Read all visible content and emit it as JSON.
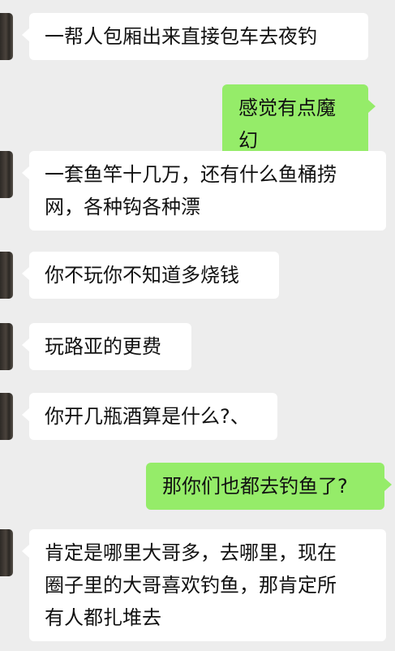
{
  "colors": {
    "background": "#ededed",
    "incoming_bubble": "#ffffff",
    "outgoing_bubble": "#95ec69",
    "text": "#111111"
  },
  "messages": [
    {
      "side": "left",
      "text": "一帮人包厢出来直接包车去夜钓"
    },
    {
      "side": "right",
      "text": "感觉有点魔幻"
    },
    {
      "side": "left",
      "text": "一套鱼竿十几万，还有什么鱼桶捞\n网，各种钩各种漂"
    },
    {
      "side": "left",
      "text": "你不玩你不知道多烧钱"
    },
    {
      "side": "left",
      "text": "玩路亚的更费"
    },
    {
      "side": "left",
      "text": "你开几瓶酒算是什么?、"
    },
    {
      "side": "right",
      "text": "那你们也都去钓鱼了?"
    },
    {
      "side": "left",
      "text": "肯定是哪里大哥多，去哪里，现在\n圈子里的大哥喜欢钓鱼，那肯定所\n有人都扎堆去"
    }
  ]
}
